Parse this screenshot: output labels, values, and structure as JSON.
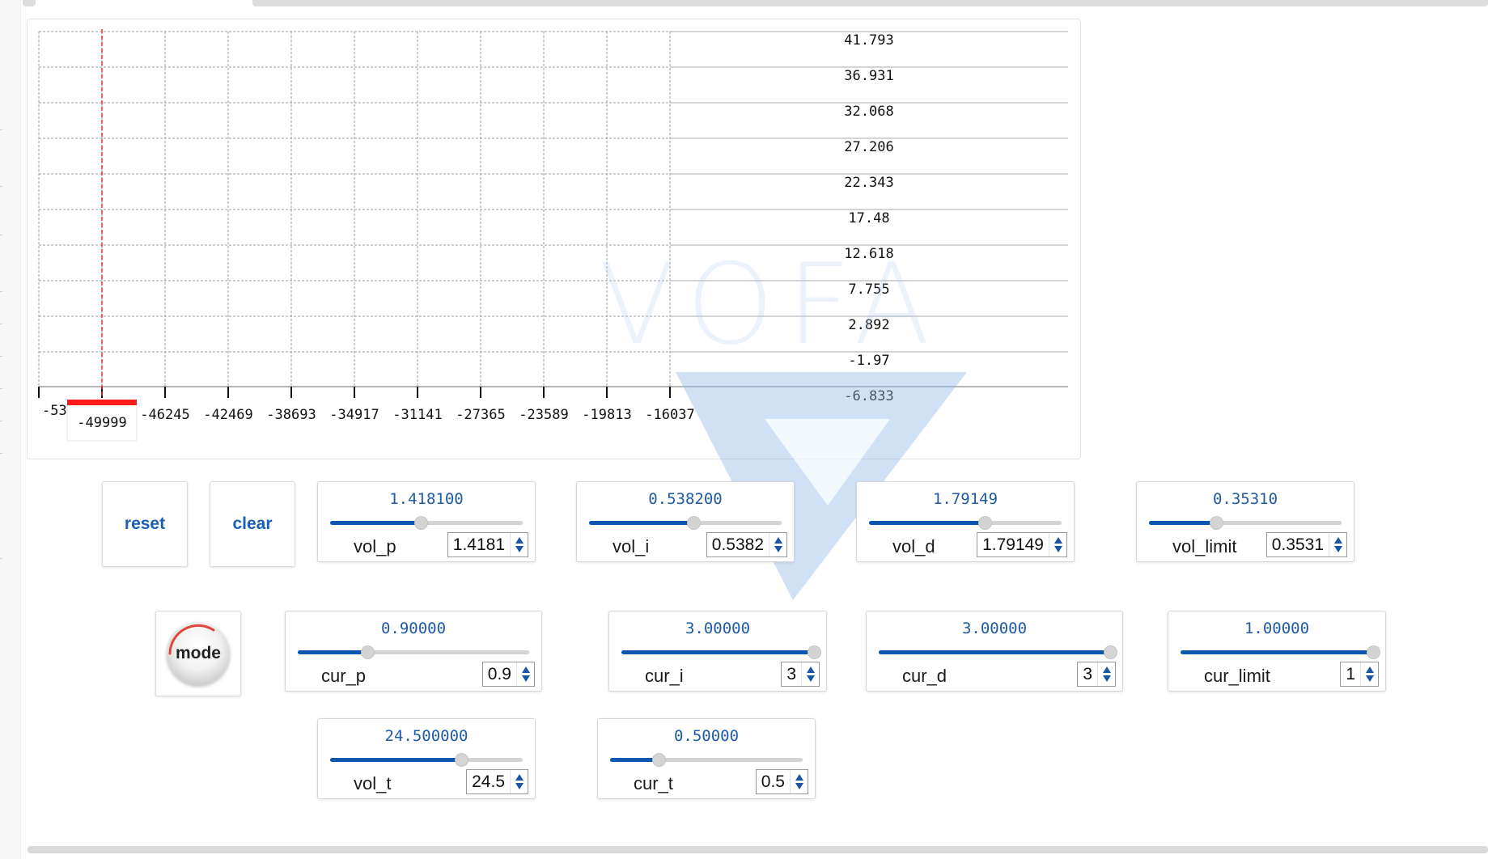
{
  "chart_data": {
    "type": "line",
    "title": "",
    "xlabel": "",
    "ylabel": "",
    "x_ticks": [
      "-53",
      "-49999",
      "-46245",
      "-42469",
      "-38693",
      "-34917",
      "-31141",
      "-27365",
      "-23589",
      "-19813",
      "-16037"
    ],
    "y_ticks": [
      "41.793",
      "36.931",
      "32.068",
      "27.206",
      "22.343",
      "17.48",
      "12.618",
      "7.755",
      "2.892",
      "-1.97",
      "-6.833"
    ],
    "ylim": [
      -6.833,
      41.793
    ],
    "cursor_x_label": "-49999",
    "grid": true,
    "series": []
  },
  "watermark": {
    "text": "VOFA"
  },
  "buttons": {
    "reset": "reset",
    "clear": "clear",
    "mode": "mode"
  },
  "sliders": [
    {
      "key": "vol_p",
      "name": "vol_p",
      "display": "1.418100",
      "spin": "1.4181",
      "fraction": 0.47,
      "accent": "#0b57b0"
    },
    {
      "key": "vol_i",
      "name": "vol_i",
      "display": "0.538200",
      "spin": "0.5382",
      "fraction": 0.54,
      "accent": "#0b57b0"
    },
    {
      "key": "vol_d",
      "name": "vol_d",
      "display": "1.79149",
      "spin": "1.79149",
      "fraction": 0.6,
      "accent": "#0b57b0"
    },
    {
      "key": "vol_limit",
      "name": "vol_limit",
      "display": "0.35310",
      "spin": "0.3531",
      "fraction": 0.35,
      "accent": "#0b57b0"
    },
    {
      "key": "cur_p",
      "name": "cur_p",
      "display": "0.90000",
      "spin": "0.9",
      "fraction": 0.3,
      "accent": "#0b57b0"
    },
    {
      "key": "cur_i",
      "name": "cur_i",
      "display": "3.00000",
      "spin": "3",
      "fraction": 1.0,
      "accent": "#0b57b0"
    },
    {
      "key": "cur_d",
      "name": "cur_d",
      "display": "3.00000",
      "spin": "3",
      "fraction": 1.0,
      "accent": "#0b57b0"
    },
    {
      "key": "cur_limit",
      "name": "cur_limit",
      "display": "1.00000",
      "spin": "1",
      "fraction": 1.0,
      "accent": "#0b57b0"
    },
    {
      "key": "vol_t",
      "name": "vol_t",
      "display": "24.500000",
      "spin": "24.5",
      "fraction": 0.68,
      "accent": "#0b57b0"
    },
    {
      "key": "cur_t",
      "name": "cur_t",
      "display": "0.50000",
      "spin": "0.5",
      "fraction": 0.25,
      "accent": "#0b57b0"
    }
  ]
}
